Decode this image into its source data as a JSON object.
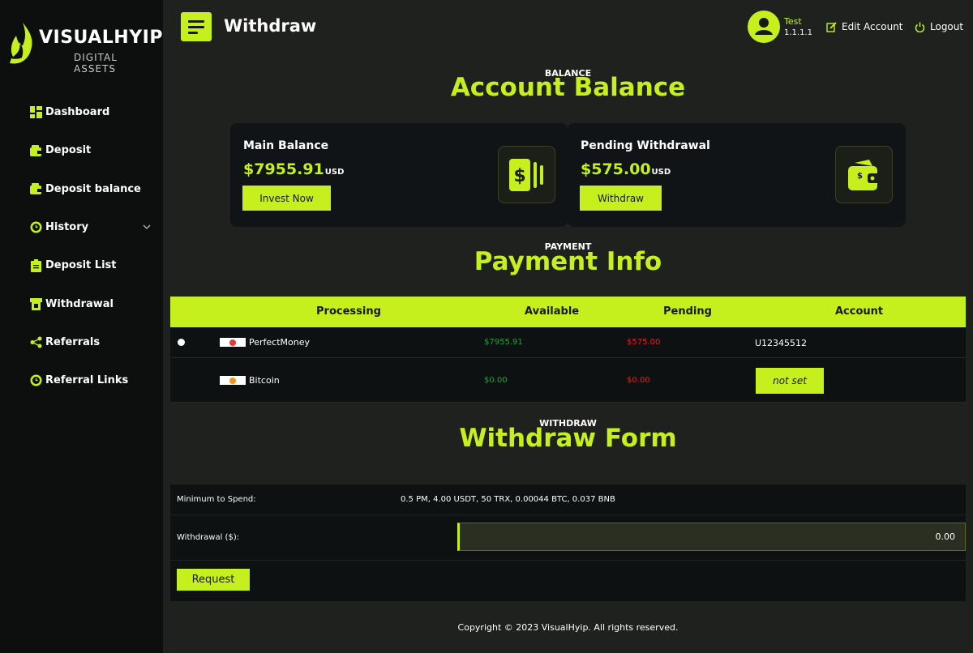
{
  "brand": {
    "name": "VISUALHYIP",
    "tagline": "DIGITAL ASSETS",
    "accent": "#c6f01d"
  },
  "sidebar": {
    "items": [
      {
        "label": "Dashboard",
        "icon": "dashboard-icon"
      },
      {
        "label": "Deposit",
        "icon": "wallet-icon"
      },
      {
        "label": "Deposit balance",
        "icon": "wallet-icon"
      },
      {
        "label": "History",
        "icon": "clock-icon",
        "has_dropdown": true
      },
      {
        "label": "Deposit List",
        "icon": "clipboard-icon"
      },
      {
        "label": "Withdrawal",
        "icon": "atm-icon"
      },
      {
        "label": "Referrals",
        "icon": "share-icon"
      },
      {
        "label": "Referral Links",
        "icon": "clock-icon"
      }
    ]
  },
  "header": {
    "title": "Withdraw",
    "user_name": "Test",
    "user_id": "1.1.1.1",
    "edit_account": "Edit Account",
    "logout": "Logout"
  },
  "balance_section": {
    "small": "BALANCE",
    "title": "Account Balance"
  },
  "cards": [
    {
      "label": "Main Balance",
      "amount": "$7955.91",
      "unit": "USD",
      "button": "Invest Now",
      "icon": "dollar-bill-icon"
    },
    {
      "label": "Pending Withdrawal",
      "amount": "$575.00",
      "unit": "USD",
      "button": "Withdraw",
      "icon": "wallet-icon"
    }
  ],
  "payment_section": {
    "small": "PAYMENT",
    "title": "Payment Info"
  },
  "payment_table": {
    "headers": [
      "Processing",
      "Available",
      "Pending",
      "Account"
    ],
    "rows": [
      {
        "selected": true,
        "name": "PerfectMoney",
        "available": "$7955.91",
        "pending": "$575.00",
        "account": "U12345512",
        "flag_color": "#e53935"
      },
      {
        "selected": false,
        "name": "Bitcoin",
        "available": "$0.00",
        "pending": "$0.00",
        "account": "not set",
        "flag_color": "#f7931a"
      }
    ]
  },
  "withdraw_section": {
    "small": "WITHDRAW",
    "title": "Withdraw Form"
  },
  "withdraw_form": {
    "min_label": "Minimum to Spend:",
    "min_value": "0.5 PM, 4.00 USDT, 50 TRX, 0.00044 BTC, 0.037 BNB",
    "amount_label": "Withdrawal ($):",
    "amount_value": "0.00",
    "button": "Request"
  },
  "footer": {
    "text": "Copyright © 2023 VisualHyip. All rights reserved."
  }
}
